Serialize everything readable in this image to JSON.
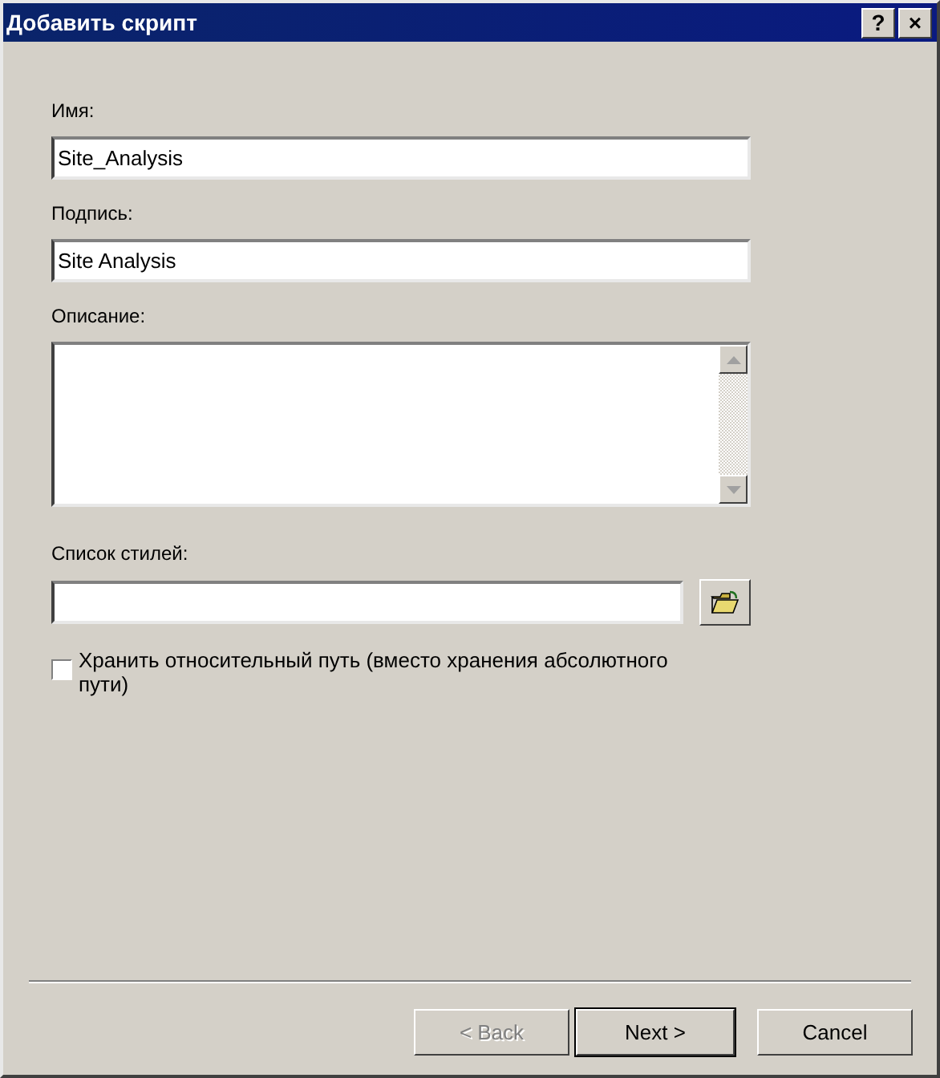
{
  "window": {
    "title": "Добавить скрипт",
    "title_buttons": [
      "?",
      "×"
    ]
  },
  "fields": [
    {
      "label": "Имя:",
      "value": "Site_Analysis"
    },
    {
      "label": "Подпись:",
      "value": "Site Analysis"
    }
  ],
  "description": {
    "label": "Описание:"
  },
  "style_list": {
    "label": "Список стилей:"
  },
  "relative_path": {
    "label": "Хранить относительный путь (вместо хранения абсолютного пути)",
    "checked": false
  },
  "buttons": [
    {
      "label": "< Back",
      "disabled": true,
      "default": false
    },
    {
      "label": "Next >",
      "disabled": false,
      "default": true
    },
    {
      "label": "Cancel",
      "disabled": false,
      "default": false
    }
  ]
}
